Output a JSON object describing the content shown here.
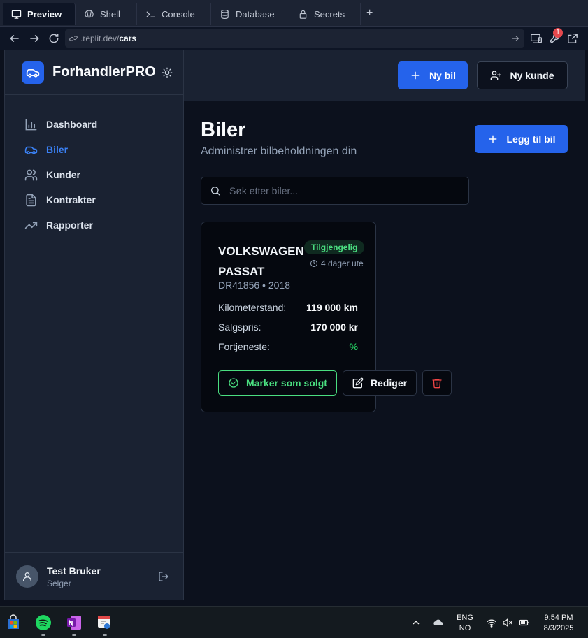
{
  "replit": {
    "tabs": [
      "Preview",
      "Shell",
      "Console",
      "Database",
      "Secrets"
    ],
    "url_prefix": ".replit.dev/",
    "url_path": "cars",
    "badge_count": "1"
  },
  "app": {
    "brand": "ForhandlerPRO",
    "nav": [
      {
        "label": "Dashboard",
        "active": false
      },
      {
        "label": "Biler",
        "active": true
      },
      {
        "label": "Kunder",
        "active": false
      },
      {
        "label": "Kontrakter",
        "active": false
      },
      {
        "label": "Rapporter",
        "active": false
      }
    ],
    "user": {
      "name": "Test Bruker",
      "role": "Selger"
    },
    "topbar": {
      "new_car": "Ny bil",
      "new_customer": "Ny kunde"
    },
    "page": {
      "title": "Biler",
      "subtitle": "Administrer bilbeholdningen din",
      "add_button": "Legg til bil",
      "search_placeholder": "Søk etter biler..."
    },
    "car": {
      "name": "VOLKSWAGEN PASSAT",
      "status": "Tilgjengelig",
      "days": "4 dager ute",
      "meta": "DR41856 • 2018",
      "rows": [
        {
          "label": "Kilometerstand:",
          "value": "119 000 km"
        },
        {
          "label": "Salgspris:",
          "value": "170 000 kr"
        },
        {
          "label": "Fortjeneste:",
          "value": "%"
        }
      ],
      "mark_sold": "Marker som solgt",
      "edit": "Rediger"
    }
  },
  "taskbar": {
    "lang": "ENG",
    "region": "NO",
    "time": "9:54 PM",
    "date": "8/3/2025"
  },
  "colors": {
    "accent": "#2563eb",
    "success": "#4ade80",
    "danger": "#ef4444",
    "sidebar_bg": "#1a2232",
    "main_bg": "#0c111d"
  }
}
